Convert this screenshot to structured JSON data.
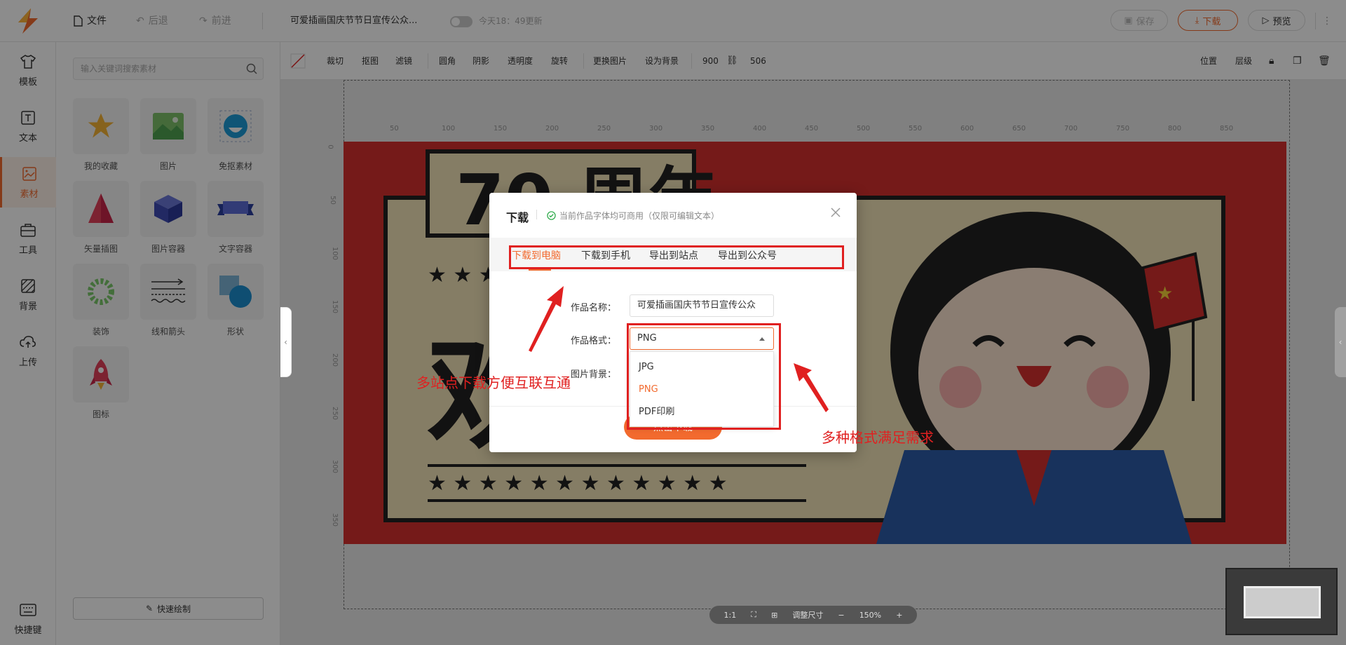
{
  "topbar": {
    "file_label": "文件",
    "undo_label": "后退",
    "redo_label": "前进",
    "doc_title": "可爱插画国庆节节日宣传公众...",
    "autosave_text": "今天18：49更新",
    "save_label": "保存",
    "download_label": "下载",
    "preview_label": "预览"
  },
  "rail": {
    "items": [
      {
        "label": "模板",
        "icon": "tshirt-icon"
      },
      {
        "label": "文本",
        "icon": "text-icon"
      },
      {
        "label": "素材",
        "icon": "image-icon"
      },
      {
        "label": "工具",
        "icon": "toolbox-icon"
      },
      {
        "label": "背景",
        "icon": "pattern-icon"
      },
      {
        "label": "上传",
        "icon": "cloud-upload-icon"
      }
    ],
    "shortcut_label": "快捷键"
  },
  "panel": {
    "search_placeholder": "输入关键词搜索素材",
    "materials": [
      {
        "label": "我的收藏",
        "icon": "star-icon"
      },
      {
        "label": "图片",
        "icon": "picture-icon"
      },
      {
        "label": "免抠素材",
        "icon": "face-icon"
      },
      {
        "label": "矢量插图",
        "icon": "tree-icon"
      },
      {
        "label": "图片容器",
        "icon": "cube-icon"
      },
      {
        "label": "文字容器",
        "icon": "ribbon-icon"
      },
      {
        "label": "装饰",
        "icon": "wreath-icon"
      },
      {
        "label": "线和箭头",
        "icon": "lines-icon"
      },
      {
        "label": "形状",
        "icon": "shapes-icon"
      },
      {
        "label": "图标",
        "icon": "rocket-icon"
      }
    ],
    "quick_draw_label": "快速绘制"
  },
  "toolbar2": {
    "items": [
      "裁切",
      "抠图",
      "滤镜",
      "圆角",
      "阴影",
      "透明度",
      "旋转",
      "更换图片",
      "设为背景"
    ],
    "width": "900",
    "height": "506",
    "right_items": [
      "位置",
      "层级"
    ]
  },
  "ruler": {
    "h_ticks": [
      "50",
      "100",
      "150",
      "200",
      "250",
      "300",
      "350",
      "400",
      "450",
      "500",
      "550",
      "600",
      "650",
      "700",
      "750",
      "800",
      "850"
    ],
    "v_ticks": [
      "0",
      "50",
      "100",
      "150",
      "200",
      "250",
      "300",
      "350"
    ]
  },
  "zoombar": {
    "ratio": "1:1",
    "fit_label": "调整尺寸",
    "zoom": "150%"
  },
  "modal": {
    "title": "下载",
    "note": "当前作品字体均可商用（仅限可编辑文本）",
    "tabs": [
      "下载到电脑",
      "下载到手机",
      "导出到站点",
      "导出到公众号"
    ],
    "name_label": "作品名称：",
    "name_value": "可爱插画国庆节节日宣传公众",
    "format_label": "作品格式：",
    "format_value": "PNG",
    "bg_label": "图片背景：",
    "format_options": [
      "JPG",
      "PNG",
      "PDF印刷"
    ],
    "download_button": "点击下载"
  },
  "annotations": {
    "left": "多站点下载方便互联互通",
    "right": "多种格式满足需求"
  },
  "colors": {
    "accent": "#f26a2e",
    "annotation": "#e02020",
    "poster_red": "#d6302f",
    "poster_beige": "#f3e3b8"
  }
}
